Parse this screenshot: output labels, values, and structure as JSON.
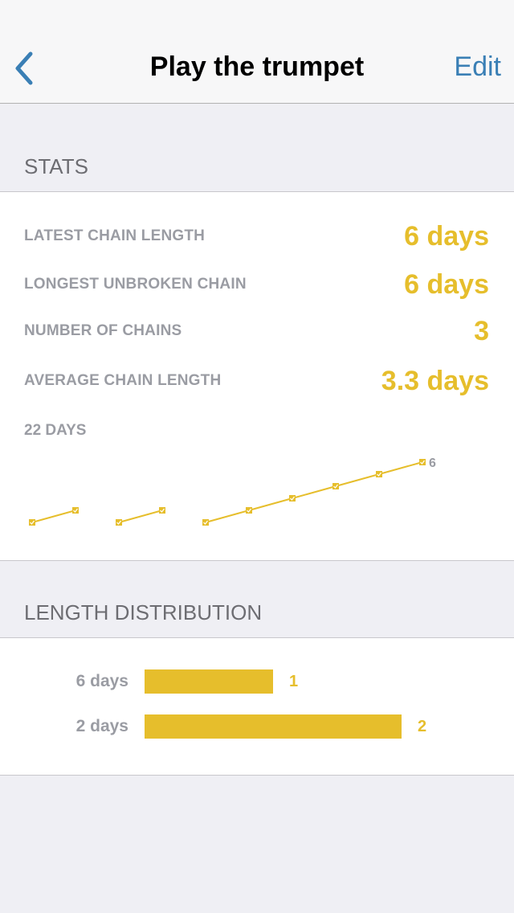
{
  "colors": {
    "accent": "#e6be2c",
    "link": "#3a7fb5",
    "label": "#9a9ca3",
    "header": "#6d6d72"
  },
  "navbar": {
    "back_icon": "chevron-left-icon",
    "title": "Play the trumpet",
    "edit_label": "Edit"
  },
  "stats": {
    "header": "STATS",
    "rows": [
      {
        "label": "LATEST CHAIN LENGTH",
        "value": "6 days"
      },
      {
        "label": "LONGEST UNBROKEN CHAIN",
        "value": "6 days"
      },
      {
        "label": "NUMBER OF CHAINS",
        "value": "3"
      },
      {
        "label": "AVERAGE CHAIN LENGTH",
        "value": "3.3 days"
      }
    ],
    "days_label": "22 DAYS",
    "last_point_label": "6"
  },
  "chart_data": {
    "type": "line",
    "series": [
      {
        "values": [
          1,
          2
        ]
      },
      {
        "values": [
          1,
          2
        ]
      },
      {
        "values": [
          1,
          2,
          3,
          4,
          5,
          6
        ]
      }
    ],
    "ylim": [
      1,
      6
    ],
    "grid": false
  },
  "distribution": {
    "header": "LENGTH DISTRIBUTION",
    "rows": [
      {
        "label": "6 days",
        "count": 1,
        "count_label": "1"
      },
      {
        "label": "2 days",
        "count": 2,
        "count_label": "2"
      }
    ],
    "max_count": 2
  }
}
